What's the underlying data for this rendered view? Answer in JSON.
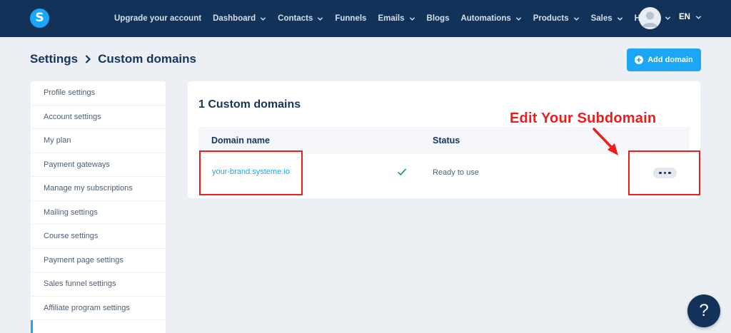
{
  "nav": {
    "logo_letter": "S",
    "items": [
      {
        "label": "Upgrade your account",
        "dropdown": false
      },
      {
        "label": "Dashboard",
        "dropdown": true
      },
      {
        "label": "Contacts",
        "dropdown": true
      },
      {
        "label": "Funnels",
        "dropdown": false
      },
      {
        "label": "Emails",
        "dropdown": true
      },
      {
        "label": "Blogs",
        "dropdown": false
      },
      {
        "label": "Automations",
        "dropdown": true
      },
      {
        "label": "Products",
        "dropdown": true
      },
      {
        "label": "Sales",
        "dropdown": true
      },
      {
        "label": "Help",
        "dropdown": false
      }
    ],
    "language": "EN",
    "avatar_icon": "user-avatar-icon"
  },
  "breadcrumb": {
    "root": "Settings",
    "current": "Custom domains"
  },
  "add_domain_label": "Add domain",
  "sidebar": {
    "items": [
      "Profile settings",
      "Account settings",
      "My plan",
      "Payment gateways",
      "Manage my subscriptions",
      "Mailing settings",
      "Course settings",
      "Payment page settings",
      "Sales funnel settings",
      "Affiliate program settings",
      ""
    ]
  },
  "main": {
    "title": "1 Custom domains",
    "columns": {
      "domain": "Domain name",
      "status": "Status"
    },
    "rows": [
      {
        "domain": "your-brand.systeme.io",
        "verified": true,
        "status": "Ready to use"
      }
    ]
  },
  "annotation": {
    "text": "Edit Your Subdomain",
    "color": "#ef1c1c"
  },
  "help_label": "?",
  "colors": {
    "navbar": "#13325a",
    "accent": "#1ba6f6",
    "background": "#ecf0f5",
    "success": "#22a55b"
  }
}
